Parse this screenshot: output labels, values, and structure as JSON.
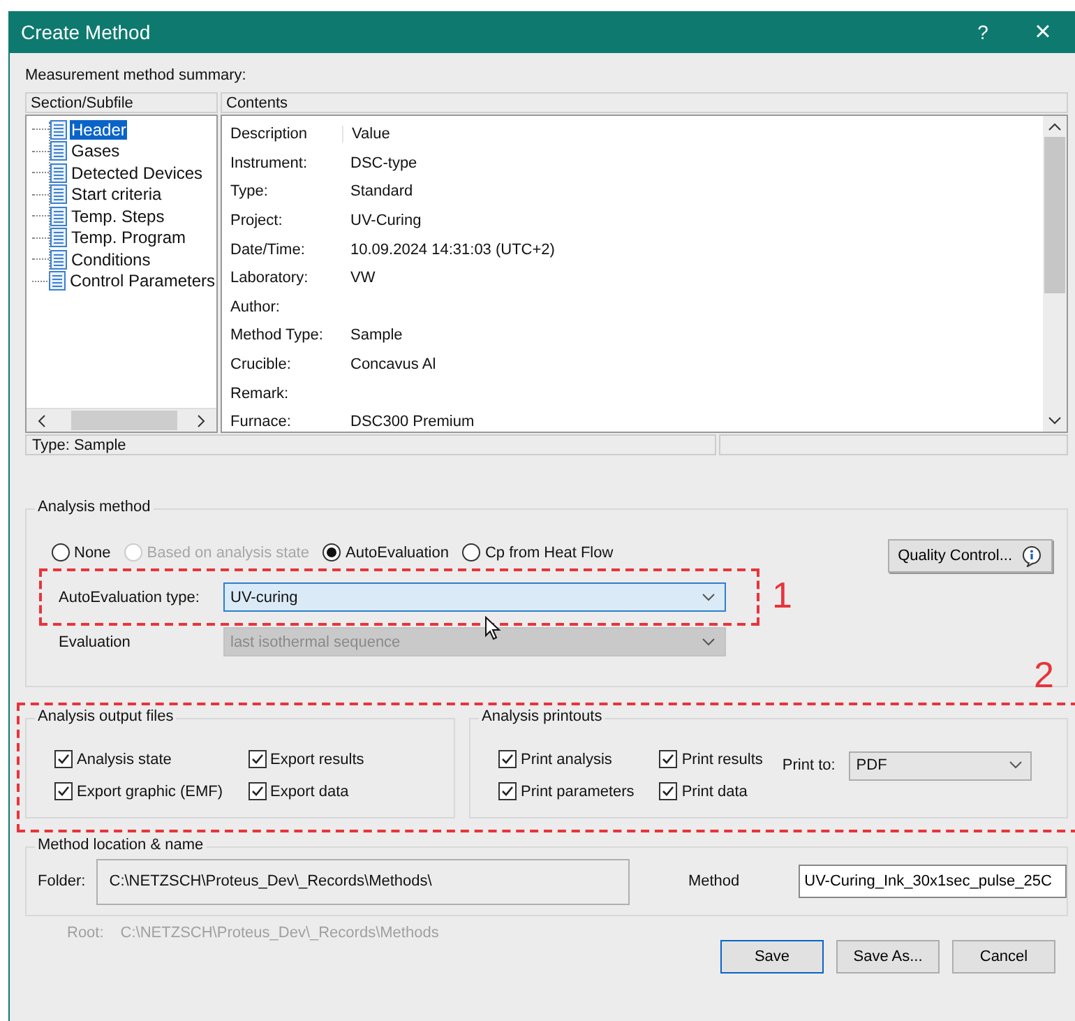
{
  "window": {
    "title": "Create Method",
    "help": "?",
    "close": "×"
  },
  "summary": {
    "label": "Measurement method summary:",
    "tree_header": "Section/Subfile",
    "contents_header": "Contents",
    "tree": [
      {
        "label": "Header",
        "selected": true
      },
      {
        "label": "Gases",
        "selected": false
      },
      {
        "label": "Detected Devices",
        "selected": false
      },
      {
        "label": "Start criteria",
        "selected": false
      },
      {
        "label": "Temp. Steps",
        "selected": false
      },
      {
        "label": "Temp. Program",
        "selected": false
      },
      {
        "label": "Conditions",
        "selected": false
      },
      {
        "label": "Control Parameters",
        "selected": false
      }
    ],
    "columns": [
      "Description",
      "Value"
    ],
    "rows": [
      [
        "Instrument:",
        "DSC-type"
      ],
      [
        "Type:",
        "Standard"
      ],
      [
        "Project:",
        "UV-Curing"
      ],
      [
        "Date/Time:",
        "10.09.2024 14:31:03 (UTC+2)"
      ],
      [
        "Laboratory:",
        "VW"
      ],
      [
        "Author:",
        ""
      ],
      [
        "Method Type:",
        "Sample"
      ],
      [
        "Crucible:",
        "Concavus Al"
      ],
      [
        "Remark:",
        ""
      ],
      [
        "Furnace:",
        "DSC300 Premium"
      ]
    ],
    "status": "Type: Sample"
  },
  "analysis_method": {
    "title": "Analysis method",
    "options": [
      {
        "label": "None",
        "selected": false,
        "disabled": false
      },
      {
        "label": "Based on analysis state",
        "selected": false,
        "disabled": true
      },
      {
        "label": "AutoEvaluation",
        "selected": true,
        "disabled": false
      },
      {
        "label": "Cp from Heat Flow",
        "selected": false,
        "disabled": false
      }
    ],
    "quality_button": "Quality Control...",
    "type_label": "AutoEvaluation type:",
    "type_value": "UV-curing",
    "type_disabled": false,
    "evaluation_label": "Evaluation",
    "evaluation_value": "last isothermal sequence",
    "evaluation_disabled": true
  },
  "output_files": {
    "title": "Analysis output files",
    "items": [
      {
        "label": "Analysis state",
        "checked": true
      },
      {
        "label": "Export results",
        "checked": true
      },
      {
        "label": "Export graphic (EMF)",
        "checked": true
      },
      {
        "label": "Export data",
        "checked": true
      }
    ]
  },
  "printouts": {
    "title": "Analysis printouts",
    "items": [
      {
        "label": "Print analysis",
        "checked": true
      },
      {
        "label": "Print results",
        "checked": true
      },
      {
        "label": "Print parameters",
        "checked": true
      },
      {
        "label": "Print data",
        "checked": true
      }
    ],
    "print_to_label": "Print to:",
    "print_to_value": "PDF"
  },
  "location": {
    "title": "Method location & name",
    "folder_label": "Folder:",
    "folder": "C:\\NETZSCH\\Proteus_Dev\\_Records\\Methods\\",
    "method_label": "Method",
    "method": "UV-Curing_Ink_30x1sec_pulse_25C"
  },
  "root": {
    "label": "Root:",
    "value": "C:\\NETZSCH\\Proteus_Dev\\_Records\\Methods"
  },
  "buttons": [
    {
      "label": "Save",
      "default": true
    },
    {
      "label": "Save As...",
      "default": false
    },
    {
      "label": "Cancel",
      "default": false
    }
  ],
  "annotations": [
    {
      "label": "1"
    },
    {
      "label": "2"
    }
  ]
}
